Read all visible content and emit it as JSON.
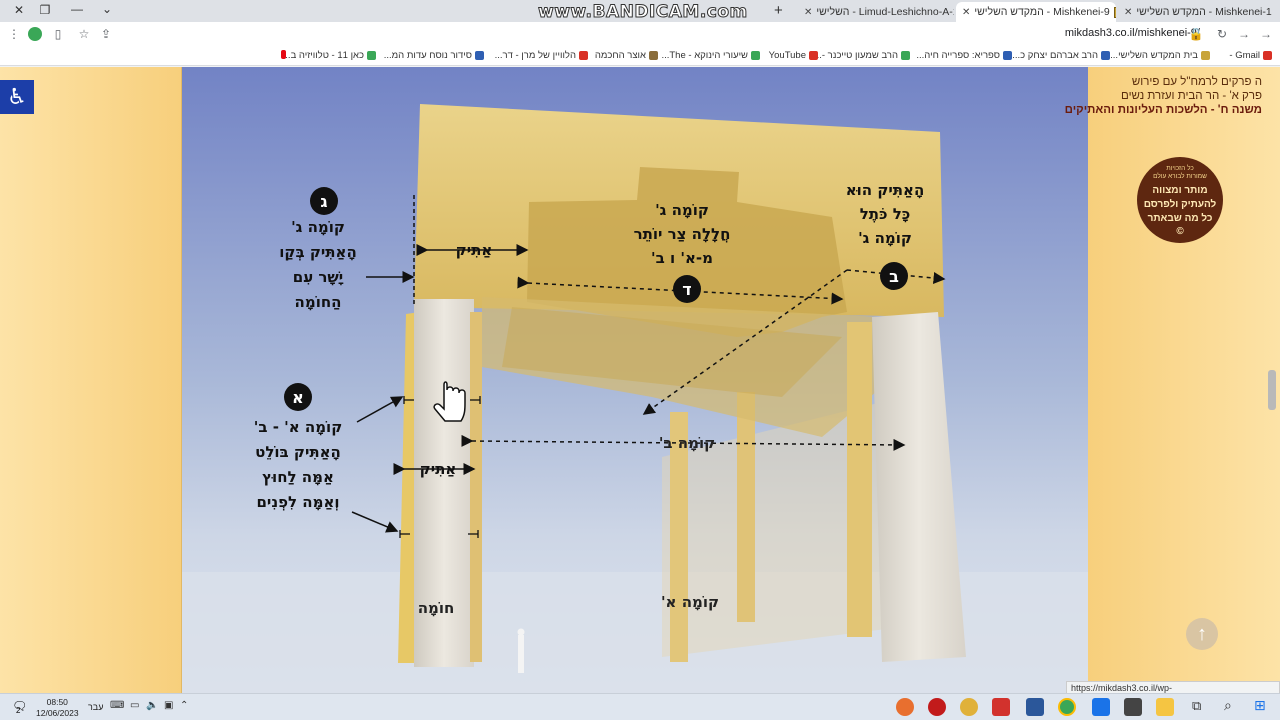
{
  "browser": {
    "watermark": "www.BANDICAM.com",
    "tabs": [
      {
        "label": "המקדש השלישי - Mishkenei-1",
        "active": false
      },
      {
        "label": "המקדש השלישי - Mishkenei-9",
        "active": true
      },
      {
        "label": "השלישי - Limud-Leshichno-A-13",
        "active": false
      }
    ],
    "new_tab": "+",
    "tab_close": "✕",
    "url": "mikdash3.co.il/mishkenei-9/",
    "bookmarks": [
      {
        "label": "Gmail -",
        "color": "#d93025"
      },
      {
        "label": "בית המקדש השלישי...",
        "color": "#c8a43a"
      },
      {
        "label": "הרב אברהם יצחק כ...",
        "color": "#2f5fb3"
      },
      {
        "label": "ספריא: ספרייה חיה...",
        "color": "#2f5fb3"
      },
      {
        "label": "הרב שמעון טייכנר -...",
        "color": "#3aa757"
      },
      {
        "label": "YouTube",
        "color": "#d93025"
      },
      {
        "label": "שיעורי הינוקא - The...",
        "color": "#3aa757"
      },
      {
        "label": "אוצר החכמה",
        "color": "#8a6d3b"
      },
      {
        "label": "הלוויין של מרן - דר...",
        "color": "#d93025"
      },
      {
        "label": "סידור נוסח עדות המ...",
        "color": "#2f5fb3"
      },
      {
        "label": "כאן 11 - טלוויזיה ב...",
        "color": "#3aa757"
      }
    ],
    "status_url": "https://mikdash3.co.il/wp-content/uploads/2023/06/57.jpg"
  },
  "right_panel": {
    "line1": "ה פרקים לרמח\"ל עם פירוש",
    "line2": "פרק א' - הר הבית ועזרת נשים",
    "line3": "משנה ח' - הלשכות העליונות והאתיקים",
    "badge_small1": "כל הזכויות",
    "badge_small2": "שמורות לבורא עולם",
    "badge_line1": "מותר ומצווה",
    "badge_line2": "להעתיק ולפרסם",
    "badge_line3": "כל מה שבאתר",
    "badge_copyright": "©"
  },
  "diagram": {
    "label_gimel": "ג",
    "gimel_text": [
      "קוֹמָה ג'",
      "הָאַתִּיק בְּקַו",
      "יָשָׁר עִם",
      "הַחוֹמָה"
    ],
    "label_alef": "א",
    "alef_text": [
      "קוֹמָה א' - ב'",
      "הָאַתִּיק בּוֹלֵט",
      "אַמָּה לַחוּץ",
      "וְאַמָּה לִפְנִים"
    ],
    "label_bet": "ב",
    "bet_text": [
      "הָאַתִּיק הוּא",
      "כָּל כֹּתֶל",
      "קוֹמָה ג'"
    ],
    "label_dalet": "ד",
    "center_text": [
      "קוֹמָה ג'",
      "חֲלָלָה צַר יוֹתֵר",
      "מ-א' ו ב'"
    ],
    "atik_top": "אַתִּיק",
    "atik_mid": "אַתִּיק",
    "floor_b": "קוֹמָה ב'",
    "floor_a": "קוֹמָה א'",
    "wall": "חוֹמָה"
  },
  "taskbar": {
    "time": "08:50",
    "date": "12/06/2023",
    "lang": "עבר",
    "notif": "2"
  }
}
